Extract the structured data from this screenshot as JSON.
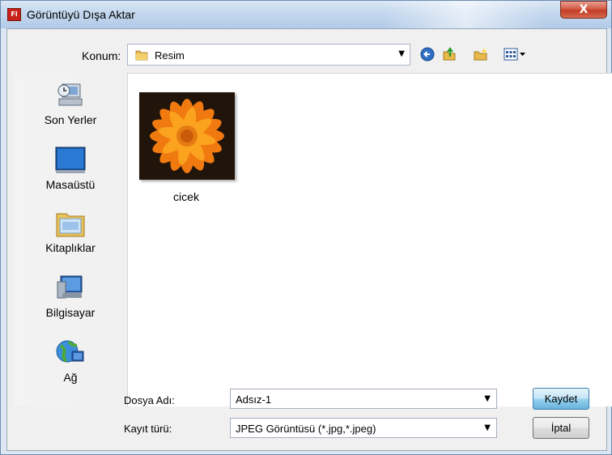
{
  "window": {
    "title": "Görüntüyü Dışa Aktar",
    "app_icon_text": "Fl",
    "close_glyph": "X"
  },
  "location": {
    "label": "Konum:",
    "value": "Resim",
    "dropdown_glyph": "▼"
  },
  "toolbar": {
    "back_icon": "back-arrow-icon",
    "up_icon": "up-folder-icon",
    "new_folder_icon": "new-folder-icon",
    "views_icon": "views-menu-icon"
  },
  "places": [
    {
      "label": "Son Yerler",
      "icon": "recent-places-icon"
    },
    {
      "label": "Masaüstü",
      "icon": "desktop-icon"
    },
    {
      "label": "Kitaplıklar",
      "icon": "libraries-icon"
    },
    {
      "label": "Bilgisayar",
      "icon": "computer-icon"
    },
    {
      "label": "Ağ",
      "icon": "network-icon"
    }
  ],
  "files": [
    {
      "name": "cicek",
      "thumbnail": "orange-flower"
    }
  ],
  "filename": {
    "label": "Dosya Adı:",
    "value": "Adsız-1"
  },
  "filetype": {
    "label": "Kayıt türü:",
    "value": "JPEG Görüntüsü (*.jpg,*.jpeg)"
  },
  "buttons": {
    "save": "Kaydet",
    "cancel": "İptal"
  },
  "colors": {
    "accent": "#3c7fb1",
    "close": "#c43c24"
  }
}
